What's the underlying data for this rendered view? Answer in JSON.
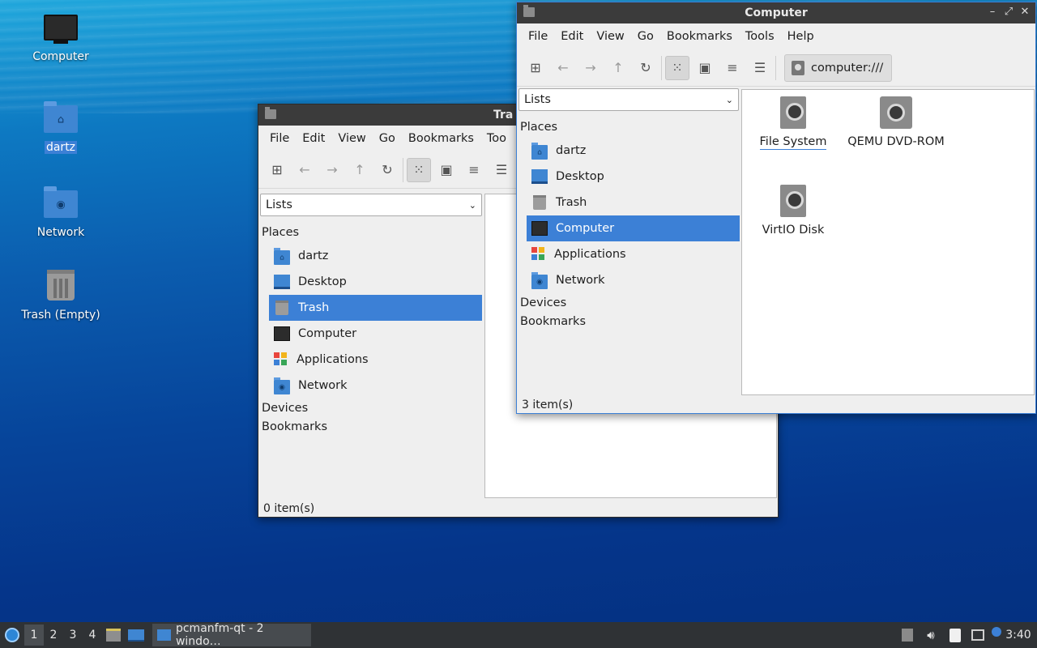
{
  "desktop": {
    "icons": [
      {
        "label": "Computer",
        "icon": "computer-icon"
      },
      {
        "label": "dartz",
        "icon": "home-folder-icon"
      },
      {
        "label": "Network",
        "icon": "network-folder-icon"
      },
      {
        "label": "Trash (Empty)",
        "icon": "trash-icon"
      }
    ]
  },
  "trash_window": {
    "title": "Tra",
    "menu": [
      "File",
      "Edit",
      "View",
      "Go",
      "Bookmarks",
      "Too"
    ],
    "side_combo": "Lists",
    "places_header": "Places",
    "places": [
      {
        "label": "dartz",
        "icon": "home-folder-icon"
      },
      {
        "label": "Desktop",
        "icon": "desktop-icon"
      },
      {
        "label": "Trash",
        "icon": "trash-icon"
      },
      {
        "label": "Computer",
        "icon": "computer-icon"
      },
      {
        "label": "Applications",
        "icon": "applications-icon"
      },
      {
        "label": "Network",
        "icon": "network-folder-icon"
      }
    ],
    "devices_header": "Devices",
    "bookmarks_header": "Bookmarks",
    "status": "0 item(s)"
  },
  "computer_window": {
    "title": "Computer",
    "menu": [
      "File",
      "Edit",
      "View",
      "Go",
      "Bookmarks",
      "Tools",
      "Help"
    ],
    "path": "computer:///",
    "side_combo": "Lists",
    "places_header": "Places",
    "places": [
      {
        "label": "dartz",
        "icon": "home-folder-icon"
      },
      {
        "label": "Desktop",
        "icon": "desktop-icon"
      },
      {
        "label": "Trash",
        "icon": "trash-icon"
      },
      {
        "label": "Computer",
        "icon": "computer-icon"
      },
      {
        "label": "Applications",
        "icon": "applications-icon"
      },
      {
        "label": "Network",
        "icon": "network-folder-icon"
      }
    ],
    "devices_header": "Devices",
    "bookmarks_header": "Bookmarks",
    "items": [
      {
        "label": "File System",
        "icon": "hard-disk-icon"
      },
      {
        "label": "QEMU DVD-ROM",
        "icon": "optical-drive-icon"
      },
      {
        "label": "VirtIO Disk",
        "icon": "hard-disk-icon"
      }
    ],
    "status": "3 item(s)"
  },
  "taskbar": {
    "desktops": [
      "1",
      "2",
      "3",
      "4"
    ],
    "task_label": "pcmanfm-qt - 2 windo…",
    "clock": "3:40"
  },
  "colors": {
    "selection": "#3c80d6",
    "titlebar": "#3b3b3b",
    "taskbar": "#2f3235"
  }
}
